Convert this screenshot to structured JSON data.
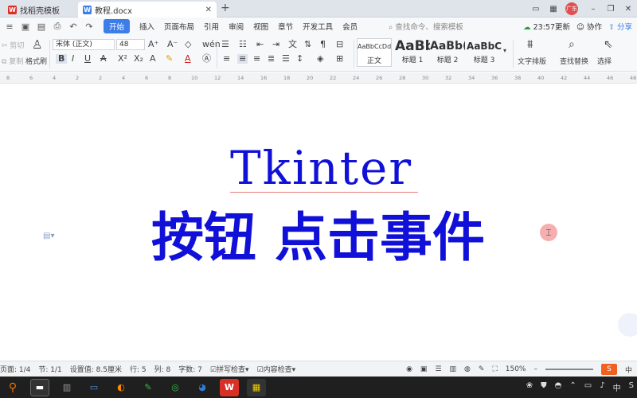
{
  "tabs": [
    {
      "label": "找稻壳模板",
      "icon": "wps-red-icon"
    },
    {
      "label": "教程.docx",
      "icon": "writer-doc-icon"
    }
  ],
  "window": {
    "avatar": "广东"
  },
  "menu": {
    "quick": [
      "save-icon",
      "print-preview-icon",
      "print-icon",
      "undo-icon",
      "redo-icon"
    ],
    "items": [
      "开始",
      "插入",
      "页面布局",
      "引用",
      "审阅",
      "视图",
      "章节",
      "开发工具",
      "会员"
    ],
    "search_placeholder": "查找命令、搜索模板",
    "time_update": "23:57更新",
    "collab": "协作",
    "share": "分享"
  },
  "ribbon": {
    "cut": "剪切",
    "copy": "复制",
    "format_painter": "格式刷",
    "font_name": "宋体 (正文)",
    "font_size": "48",
    "styles": [
      {
        "preview": "AaBbCcDd",
        "label": "正文"
      },
      {
        "preview": "AaBb",
        "label": "标题 1"
      },
      {
        "preview": "AaBb(",
        "label": "标题 2"
      },
      {
        "preview": "AaBbC",
        "label": "标题 3"
      }
    ],
    "text_layout": "文字排版",
    "find_replace": "查找替换",
    "select": "选择"
  },
  "ruler": {
    "ticks": [
      "8",
      "6",
      "4",
      "2",
      "2",
      "4",
      "6",
      "8",
      "10",
      "12",
      "14",
      "16",
      "18",
      "20",
      "22",
      "24",
      "26",
      "28",
      "30",
      "32",
      "34",
      "36",
      "38",
      "40",
      "42",
      "44",
      "46",
      "48"
    ]
  },
  "document": {
    "line1": "Tkinter",
    "line2": "按钮 点击事件"
  },
  "status": {
    "page": "页面: 1/4",
    "section": "节: 1/1",
    "setting": "设置值: 8.5厘米",
    "row": "行: 5",
    "col": "列: 8",
    "words": "字数: 7",
    "spell": "拼写检查",
    "content_check": "内容检查",
    "zoom": "150%",
    "ime": "中"
  },
  "taskbar": {
    "lang": "中"
  },
  "colors": {
    "accent": "#3b7de9",
    "doc_text": "#1010d8",
    "taskbar": "#1f1f1f"
  }
}
